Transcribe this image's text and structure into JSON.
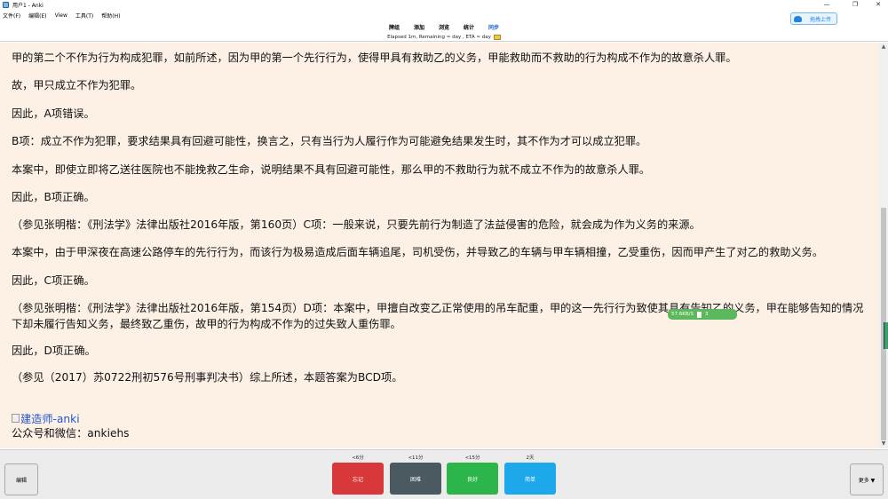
{
  "window": {
    "title": "用户1 - Anki",
    "controls": [
      "—",
      "❐",
      "✕"
    ]
  },
  "menu": [
    "文件(F)",
    "编辑(E)",
    "View",
    "工具(T)",
    "帮助(H)"
  ],
  "upload": {
    "label": "拖拽上传"
  },
  "toolbar": {
    "links": [
      "牌组",
      "添加",
      "浏览",
      "统计",
      "同步"
    ],
    "status": "Elapsed 1m, Remaining ≈ day , ETA ≈ day"
  },
  "card": {
    "paragraphs": [
      "甲的第二个不作为行为构成犯罪，如前所述，因为甲的第一个先行行为，使得甲具有救助乙的义务，甲能救助而不救助的行为构成不作为的故意杀人罪。",
      "故，甲只成立不作为犯罪。",
      "因此，A项错误。",
      "B项：成立不作为犯罪，要求结果具有回避可能性，换言之，只有当行为人履行作为可能避免结果发生时，其不作为才可以成立犯罪。",
      "本案中，即使立即将乙送往医院也不能挽救乙生命，说明结果不具有回避可能性，那么甲的不救助行为就不成立不作为的故意杀人罪。",
      "因此，B项正确。",
      "（参见张明楷：《刑法学》法律出版社2016年版，第160页）C项：一般来说，只要先前行为制造了法益侵害的危险，就会成为作为义务的来源。",
      "本案中，由于甲深夜在高速公路停车的先行行为，而该行为极易造成后面车辆追尾，司机受伤，并导致乙的车辆与甲车辆相撞，乙受重伤，因而甲产生了对乙的救助义务。",
      "因此，C项正确。",
      "（参见张明楷：《刑法学》法律出版社2016年版，第154页）D项：本案中，甲擅自改变乙正常使用的吊车配重，甲的这一先行行为致使其具有告知乙的义务，甲在能够告知的情况下却未履行告知义务，最终致乙重伤，故甲的行为构成不作为的过失致人重伤罪。",
      "因此，D项正确。",
      "（参见（2017）苏0722刑初576号刑事判决书）综上所述，本题答案为BCD项。"
    ],
    "image_alt": "建造师-anki",
    "footer": "公众号和微信：ankiehs"
  },
  "overlay": {
    "speed": "57.6KB/S",
    "count": "3"
  },
  "bottom": {
    "edit_label": "编辑",
    "more_label": "更多 ▼",
    "ease": [
      {
        "time": "<6分",
        "label": "忘记",
        "color": "#d8383a"
      },
      {
        "time": "<11分",
        "label": "困难",
        "color": "#4a5a60"
      },
      {
        "time": "<15分",
        "label": "良好",
        "color": "#2cb54b"
      },
      {
        "time": "2天",
        "label": "简单",
        "color": "#1ca8eb"
      }
    ]
  }
}
